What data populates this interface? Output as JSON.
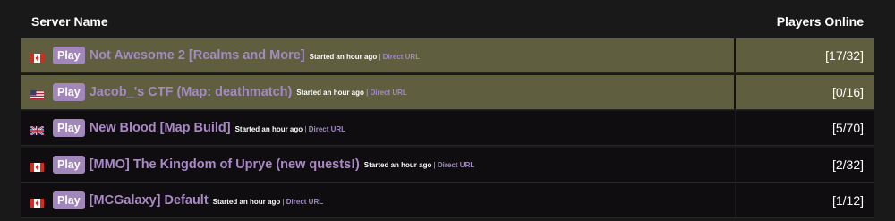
{
  "header": {
    "server_name": "Server Name",
    "players_online": "Players Online"
  },
  "colors": {
    "highlight_row": "#5f5e3e",
    "dark_row": "#0f0d0f",
    "play_button": "#a287ba",
    "server_link": "#a989c6"
  },
  "servers": [
    {
      "flag": "canada-flag-icon",
      "play_label": "Play",
      "name": "Not Awesome 2 [Realms and More]",
      "started": "Started an hour ago",
      "separator": "|",
      "direct_url": "Direct URL",
      "players": "[17/32]",
      "highlighted": true
    },
    {
      "flag": "usa-flag-icon",
      "play_label": "Play",
      "name": "Jacob_'s CTF (Map: deathmatch)",
      "started": "Started an hour ago",
      "separator": "|",
      "direct_url": "Direct URL",
      "players": "[0/16]",
      "highlighted": true
    },
    {
      "flag": "uk-flag-icon",
      "play_label": "Play",
      "name": "New Blood [Map Build]",
      "started": "Started an hour ago",
      "separator": "|",
      "direct_url": "Direct URL",
      "players": "[5/70]",
      "highlighted": false
    },
    {
      "flag": "canada-flag-icon",
      "play_label": "Play",
      "name": "[MMO] The Kingdom of Uprye (new quests!)",
      "started": "Started an hour ago",
      "separator": "|",
      "direct_url": "Direct URL",
      "players": "[2/32]",
      "highlighted": false
    },
    {
      "flag": "canada-flag-icon",
      "play_label": "Play",
      "name": "[MCGalaxy] Default",
      "started": "Started an hour ago",
      "separator": "|",
      "direct_url": "Direct URL",
      "players": "[1/12]",
      "highlighted": false
    }
  ]
}
